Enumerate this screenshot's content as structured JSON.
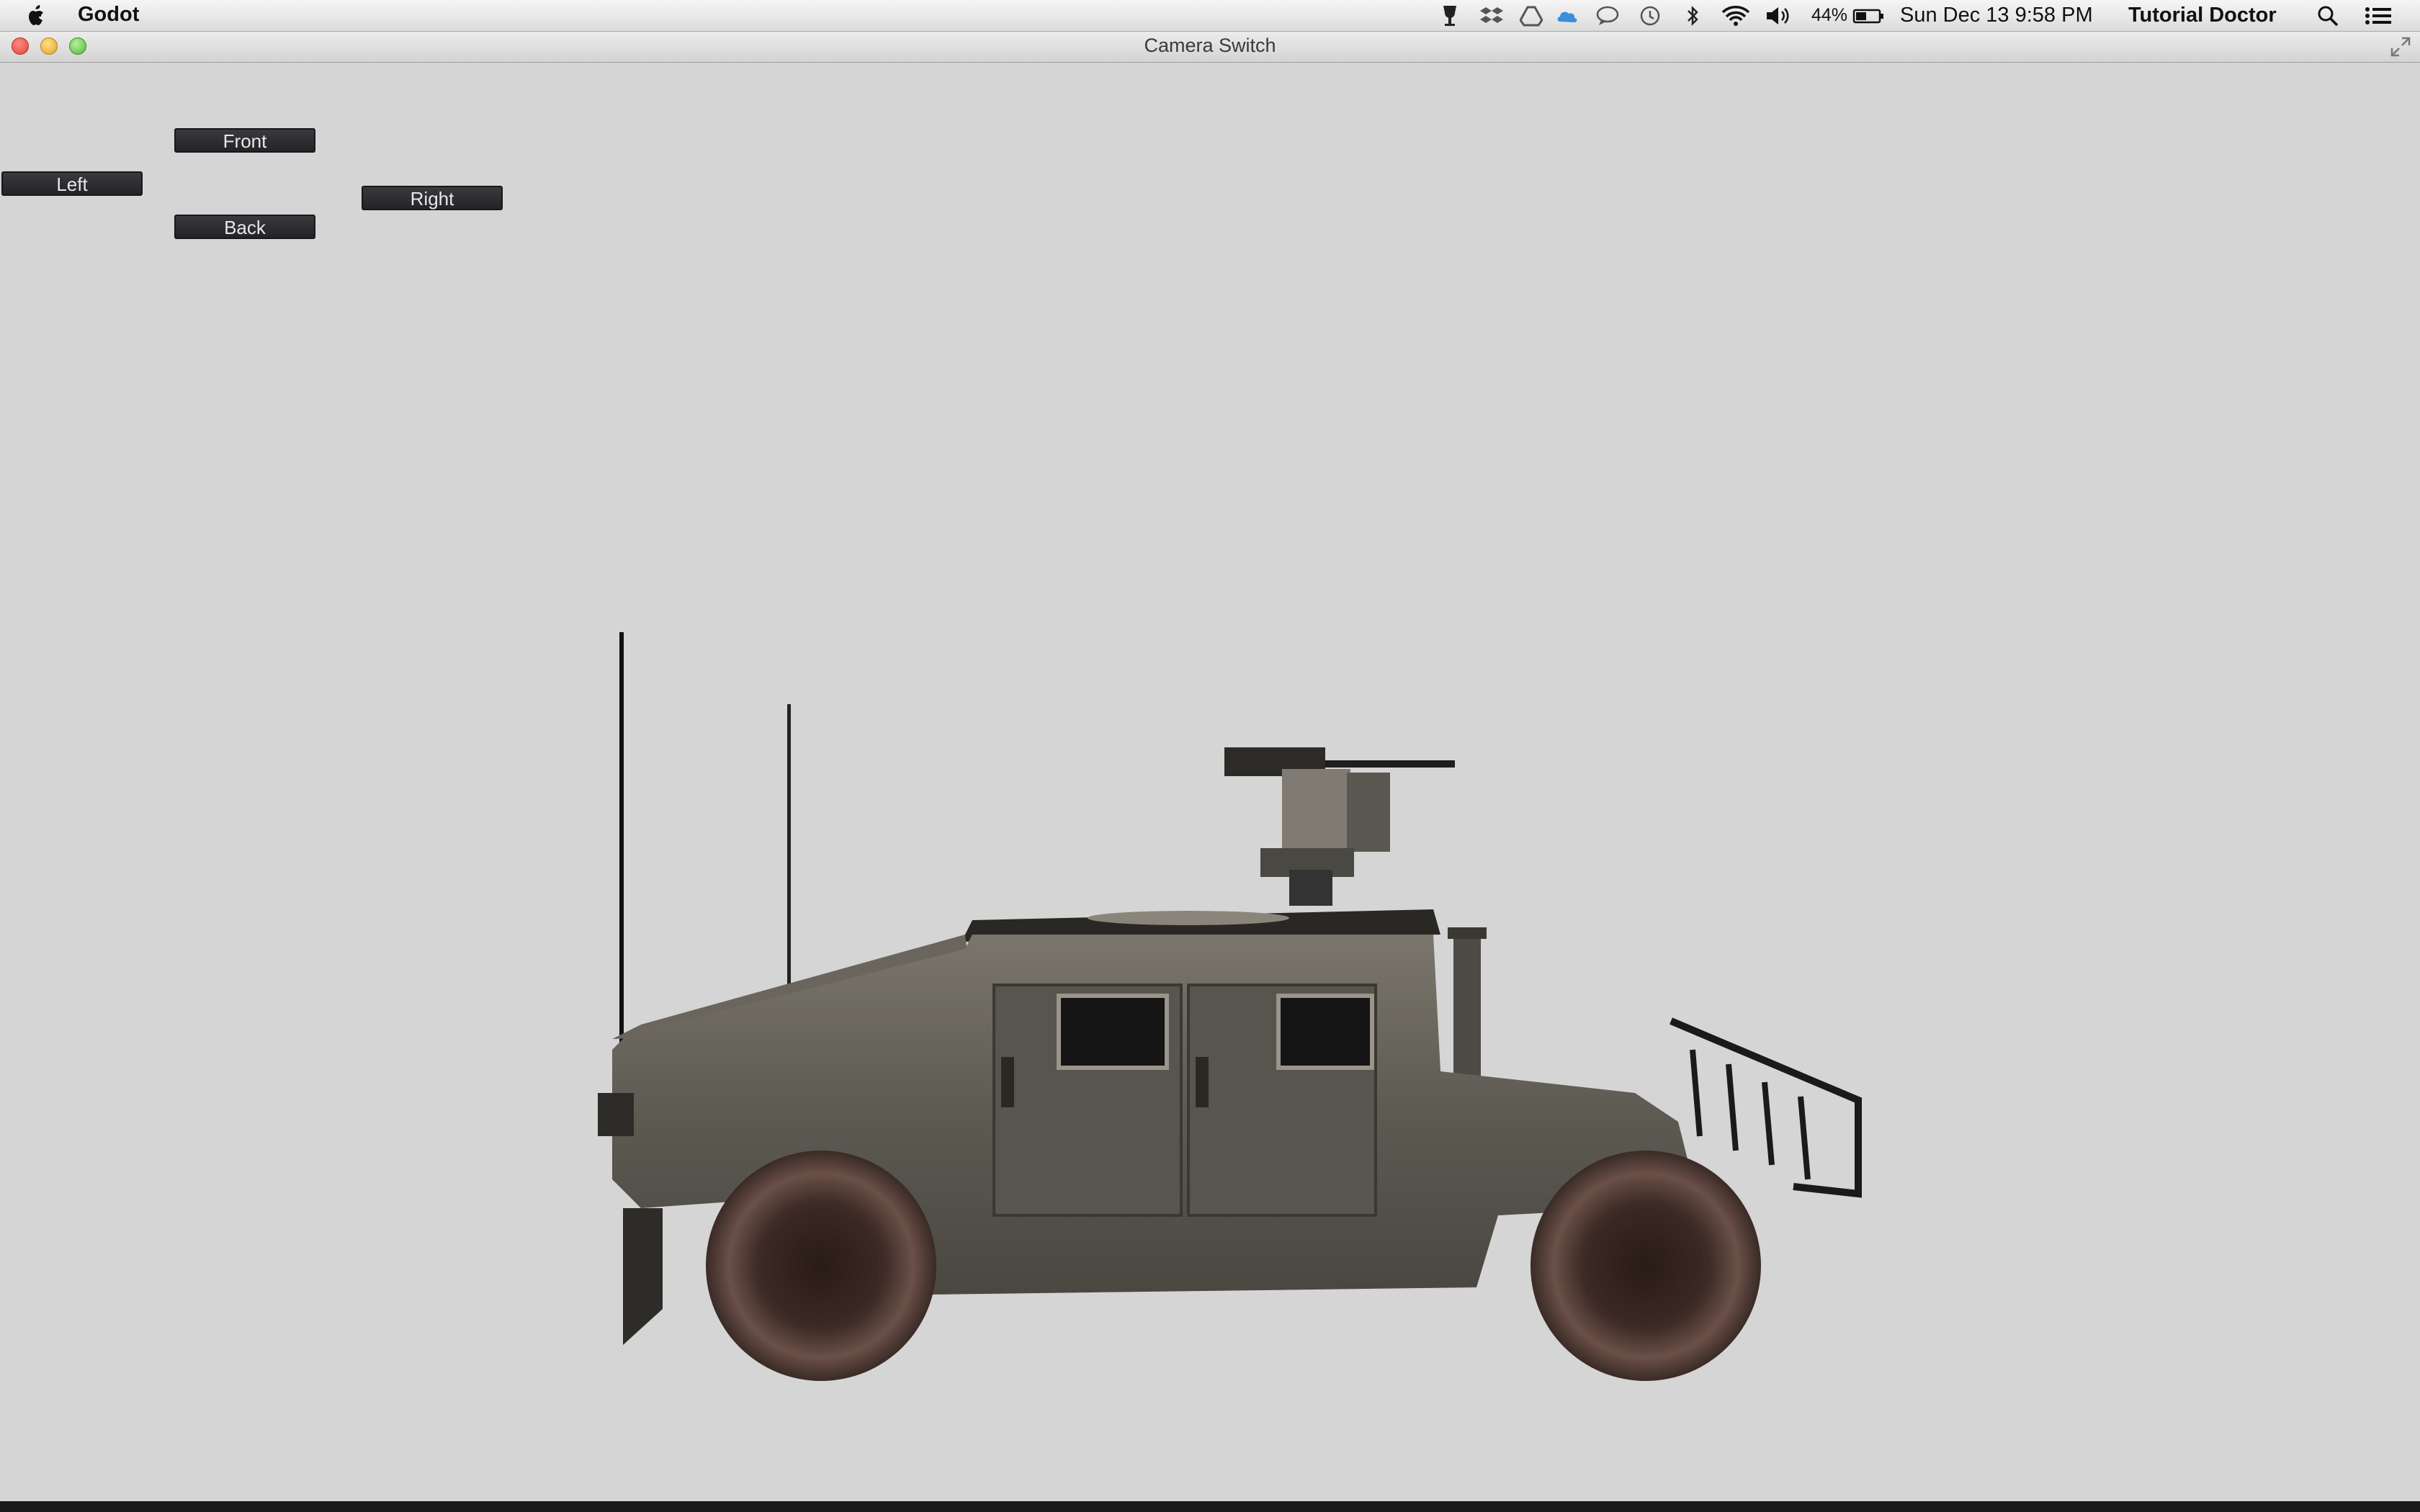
{
  "menubar": {
    "app_name": "Godot",
    "battery_percent": "44%",
    "datetime": "Sun Dec 13  9:58 PM",
    "user": "Tutorial Doctor",
    "icons": [
      "apple-logo-icon",
      "wine-icon",
      "dropbox-icon",
      "drive-icon",
      "cloud-app-icon",
      "messages-icon",
      "time-machine-icon",
      "bluetooth-icon",
      "wifi-icon",
      "volume-icon",
      "battery-icon",
      "spotlight-search-icon",
      "notification-center-icon"
    ]
  },
  "window": {
    "title": "Camera Switch"
  },
  "camera_buttons": {
    "front": "Front",
    "left": "Left",
    "right": "Right",
    "back": "Back"
  },
  "scene": {
    "background_color": "#d5d5d5",
    "object": "humvee-model"
  }
}
